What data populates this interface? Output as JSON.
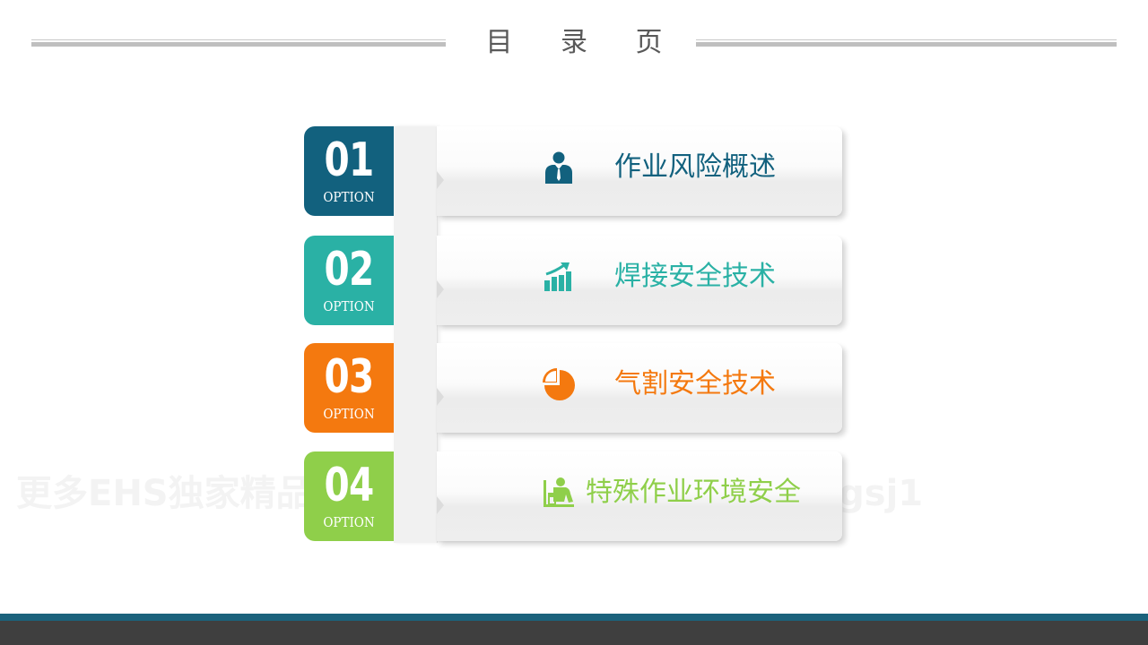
{
  "header": {
    "title": "目 录 页"
  },
  "watermark": {
    "text": "更多EHS独家精品资料请关注微信公众号：ansyingsj1"
  },
  "menu": {
    "items": [
      {
        "number": "01",
        "option": "OPTION",
        "label": "作业风险概述",
        "icon": "person-icon",
        "color": "#12617e"
      },
      {
        "number": "02",
        "option": "OPTION",
        "label": "焊接安全技术",
        "icon": "growth-chart-icon",
        "color": "#2ab1a5"
      },
      {
        "number": "03",
        "option": "OPTION",
        "label": "气割安全技术",
        "icon": "pie-chart-icon",
        "color": "#f4790f"
      },
      {
        "number": "04",
        "option": "OPTION",
        "label": "特殊作业环境安全",
        "icon": "worker-at-desk-icon",
        "color": "#8fcf4a"
      }
    ]
  },
  "theme": {
    "footer_accent": "#1b627c",
    "footer_bar": "#3f3f3f",
    "rule_color": "#bfbfbf",
    "title_color": "#595959"
  }
}
